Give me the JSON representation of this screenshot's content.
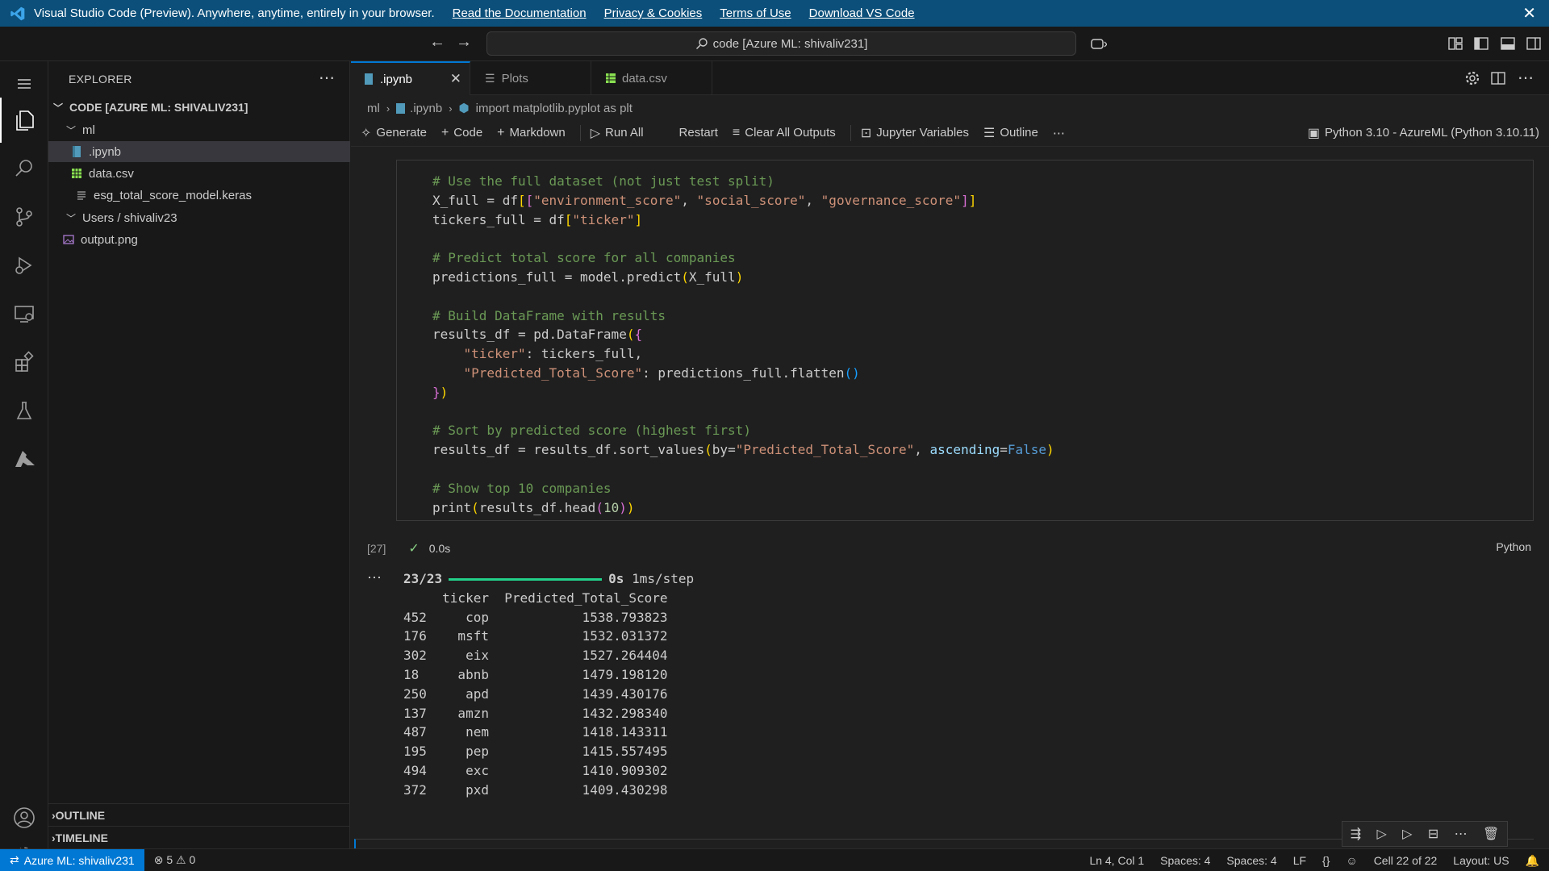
{
  "banner": {
    "text": "Visual Studio Code (Preview). Anywhere, anytime, entirely in your browser.",
    "links": [
      "Read the Documentation",
      "Privacy & Cookies",
      "Terms of Use",
      "Download VS Code"
    ]
  },
  "titlebar": {
    "search": "code [Azure ML: shivaliv231]"
  },
  "sidebar": {
    "title": "EXPLORER",
    "root": "CODE [AZURE ML: SHIVALIV231]",
    "folder_ml": "ml",
    "files": [
      ".ipynb",
      "data.csv",
      "esg_total_score_model.keras"
    ],
    "folder_users": "Users / shivaliv23",
    "output_file": "output.png",
    "outline": "OUTLINE",
    "timeline": "TIMELINE"
  },
  "tabs": [
    ".ipynb",
    "Plots",
    "data.csv"
  ],
  "breadcrumb": [
    "ml",
    ".ipynb",
    "import matplotlib.pyplot as plt"
  ],
  "toolbar": {
    "generate": "Generate",
    "code": "Code",
    "markdown": "Markdown",
    "run_all": "Run All",
    "restart": "Restart",
    "clear": "Clear All Outputs",
    "variables": "Jupyter Variables",
    "outline": "Outline",
    "kernel": "Python 3.10 - AzureML (Python 3.10.11)"
  },
  "cell": {
    "exec_count": "[27]",
    "duration": "0.0s",
    "language": "Python"
  },
  "output": {
    "progress_label": "23/23",
    "progress_fraction": 1.0,
    "progress_time": "0s",
    "progress_step": "1ms/step",
    "header": "     ticker  Predicted_Total_Score",
    "rows": [
      "452     cop            1538.793823",
      "176    msft            1532.031372",
      "302     eix            1527.264404",
      "18     abnb            1479.198120",
      "250     apd            1439.430176",
      "137    amzn            1432.298340",
      "487     nem            1418.143311",
      "195     pep            1415.557495",
      "494     exc            1410.909302",
      "372     pxd            1409.430298"
    ]
  },
  "statusbar": {
    "remote": "Azure ML: shivaliv231",
    "errors": "5",
    "warnings": "0",
    "position": "Ln 4, Col 1",
    "spaces1": "Spaces: 4",
    "spaces2": "Spaces: 4",
    "eol": "LF",
    "braces": "{}",
    "cell": "Cell 22 of 22",
    "layout": "Layout: US"
  },
  "colors": {
    "accent": "#0078d4",
    "banner": "#0b4f7a",
    "progress": "#23d18b"
  }
}
